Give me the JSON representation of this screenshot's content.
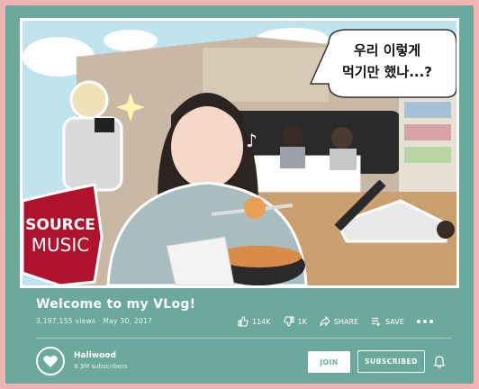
{
  "video": {
    "title": "Welcome to my VLog!",
    "views": "3,197,155 views",
    "separator": " · ",
    "date": "May 30, 2017",
    "thumbnail": {
      "caption_line1": "우리 이렇게",
      "caption_line2": "먹기만 했나...?",
      "logo_line1": "SOURCE",
      "logo_line2": "MUSIC"
    }
  },
  "actions": {
    "like_count": "114K",
    "dislike_count": "1K",
    "share_label": "SHARE",
    "save_label": "SAVE"
  },
  "channel": {
    "name": "Haliwood",
    "subscribers": "8.3M subscribers",
    "join_label": "JOIN",
    "subscribed_label": "SUBSCRIBED"
  },
  "colors": {
    "page_background": "#f2b3b3",
    "card": "#6aa99b",
    "text": "#ffffff",
    "logo_red": "#b0112c"
  }
}
